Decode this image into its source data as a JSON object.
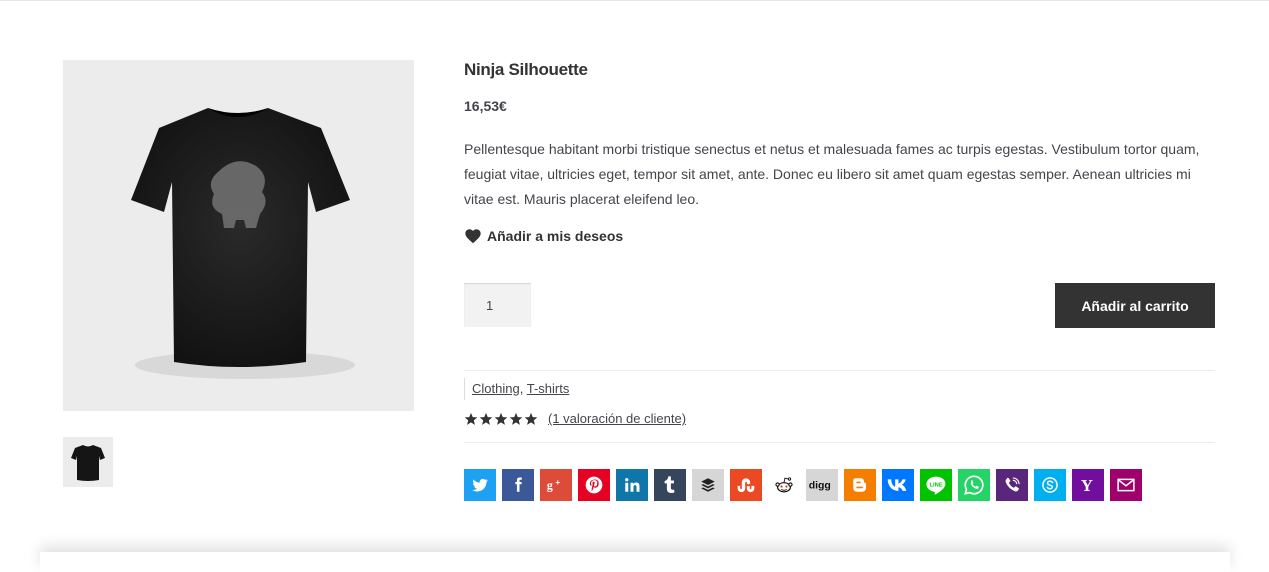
{
  "product": {
    "title": "Ninja Silhouette",
    "price": "16,53€",
    "description": "Pellentesque habitant morbi tristique senectus et netus et malesuada fames ac turpis egestas. Vestibulum tortor quam, feugiat vitae, ultricies eget, tempor sit amet, ante. Donec eu libero sit amet quam egestas semper. Aenean ultricies mi vitae est. Mauris placerat eleifend leo.",
    "wishlist_label": "Añadir a mis deseos",
    "quantity": "1",
    "add_to_cart_label": "Añadir al carrito",
    "category_separator": ",",
    "categories": [
      "Clothing",
      "T-shirts"
    ],
    "rating": {
      "stars": 5,
      "max": 5,
      "reviews_label": "(1 valoración de cliente)"
    }
  },
  "colors": {
    "text": "#43454b",
    "title": "#333333",
    "button_bg": "#333333",
    "image_bg": "#ececec"
  },
  "share_buttons": [
    {
      "name": "twitter-icon",
      "color": "#1da1f2"
    },
    {
      "name": "facebook-icon",
      "color": "#3b5998"
    },
    {
      "name": "google-plus-icon",
      "color": "#dd4b39"
    },
    {
      "name": "pinterest-icon",
      "color": "#e60023"
    },
    {
      "name": "linkedin-icon",
      "color": "#0e76a8"
    },
    {
      "name": "tumblr-icon",
      "color": "#35465c"
    },
    {
      "name": "buffer-icon",
      "color": "#d6d6d6"
    },
    {
      "name": "stumbleupon-icon",
      "color": "#eb4924"
    },
    {
      "name": "reddit-icon",
      "color": "#ffffff"
    },
    {
      "name": "digg-icon",
      "color": "#d6d6d6"
    },
    {
      "name": "blogger-icon",
      "color": "#f57d00"
    },
    {
      "name": "vk-icon",
      "color": "#0077ff"
    },
    {
      "name": "line-icon",
      "color": "#00c300"
    },
    {
      "name": "whatsapp-icon",
      "color": "#25d366"
    },
    {
      "name": "viber-icon",
      "color": "#59267c"
    },
    {
      "name": "skype-icon",
      "color": "#00aff0"
    },
    {
      "name": "yahoo-icon",
      "color": "#720e9e"
    },
    {
      "name": "email-icon",
      "color": "#a0006b"
    }
  ]
}
